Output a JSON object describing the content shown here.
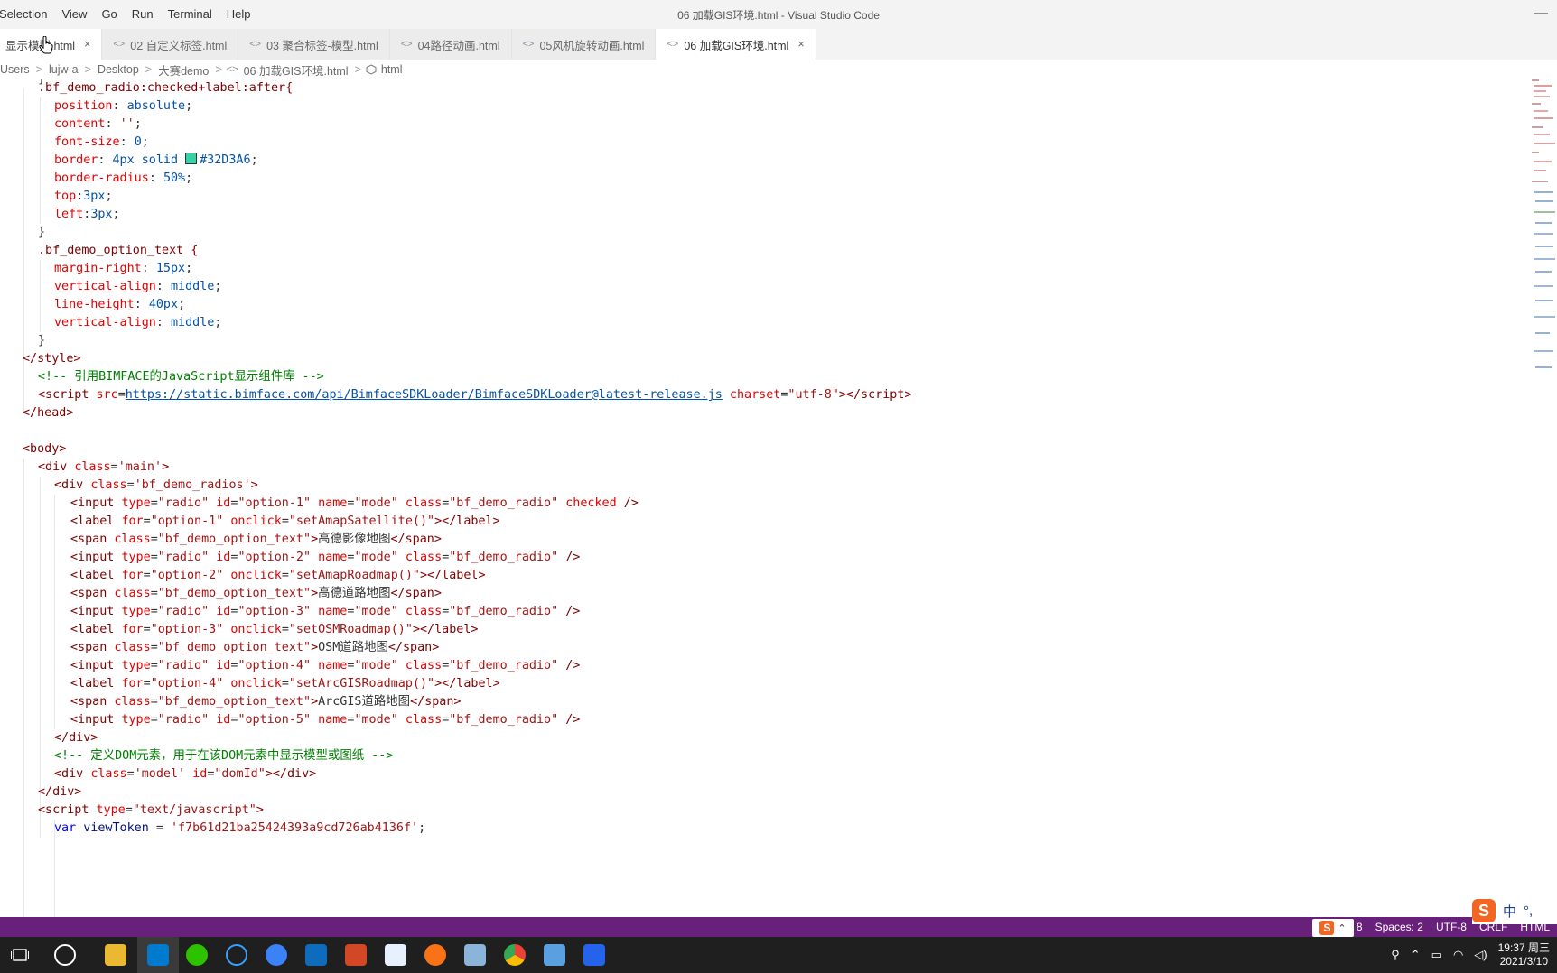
{
  "menu": [
    "Selection",
    "View",
    "Go",
    "Run",
    "Terminal",
    "Help"
  ],
  "window_title": "06 加载GIS环境.html - Visual Studio Code",
  "window_minimize": "—",
  "tabs": [
    {
      "label": "显示模型.html",
      "close": "×"
    },
    {
      "label": "02 自定义标签.html"
    },
    {
      "label": "03 聚合标签-模型.html"
    },
    {
      "label": "04路径动画.html"
    },
    {
      "label": "05风机旋转动画.html"
    },
    {
      "label": "06 加载GIS环境.html",
      "close": "×"
    }
  ],
  "tab_icon_glyph": "<>",
  "breadcrumb": [
    "Users",
    "lujw-a",
    "Desktop",
    "大赛demo",
    "06 加载GIS环境.html",
    "html"
  ],
  "breadcrumb_sep": ">",
  "code": {
    "l1": "}",
    "l2_sel": ".bf_demo_radio:checked+label:after{",
    "l3_p": "position",
    "l3_v": "absolute",
    "l4_p": "content",
    "l4_v": "''",
    "l5_p": "font-size",
    "l5_v": "0",
    "l6_p": "border",
    "l6_v": "4px solid",
    "l6_color": "#32D3A6",
    "l7_p": "border-radius",
    "l7_v": "50%",
    "l8_p": "top",
    "l8_v": "3px",
    "l9_p": "left",
    "l9_v": "3px",
    "l10": "}",
    "l11_sel": ".bf_demo_option_text {",
    "l12_p": "margin-right",
    "l12_v": "15px",
    "l13_p": "vertical-align",
    "l13_v": "middle",
    "l14_p": "line-height",
    "l14_v": "40px",
    "l15_p": "vertical-align",
    "l15_v": "middle",
    "l16": "}",
    "l17": "</style>",
    "l18": "<!-- 引用BIMFACE的JavaScript显示组件库 -->",
    "l19_url": "https://static.bimface.com/api/BimfaceSDKLoader/BimfaceSDKLoader@latest-release.js",
    "l19_charset": "\"utf-8\"",
    "l20": "</head>",
    "l22": "<body>",
    "l23_val": "'main'",
    "l24_val": "'bf_demo_radios'",
    "radio_class": "\"bf_demo_radio\"",
    "mode": "\"mode\"",
    "opt_text_class": "\"bf_demo_option_text\"",
    "opt1_id": "\"option-1\"",
    "opt1_fn": "\"setAmapSatellite()\"",
    "opt1_text": "高德影像地图",
    "opt2_id": "\"option-2\"",
    "opt2_fn": "\"setAmapRoadmap()\"",
    "opt2_text": "高德道路地图",
    "opt3_id": "\"option-3\"",
    "opt3_fn": "\"setOSMRoadmap()\"",
    "opt3_text": "OSM道路地图",
    "opt4_id": "\"option-4\"",
    "opt4_fn": "\"setArcGISRoadmap()\"",
    "opt4_text": "ArcGIS道路地图",
    "opt5_id": "\"option-5\"",
    "l41": "</div>",
    "l42": "<!-- 定义DOM元素，用于在该DOM元素中显示模型或图纸 -->",
    "l43_class": "'model'",
    "l43_id": "\"domId\"",
    "l44": "</div>",
    "l45_type": "\"text/javascript\"",
    "l46_name": "viewToken",
    "l46_val": "'f7b61d21ba25424393a9cd726ab4136f'"
  },
  "status": {
    "pos": "L 8",
    "spaces": "Spaces: 2",
    "encoding": "UTF-8",
    "eol": "CRLF",
    "lang": "HTML"
  },
  "ime": {
    "logo": "S",
    "mode": "中",
    "punct": "°,"
  },
  "clock": {
    "time": "19:37 周三",
    "date": "2021/3/10"
  },
  "colors": {
    "status_bg": "#68217a",
    "swatch": "#32D3A6"
  }
}
